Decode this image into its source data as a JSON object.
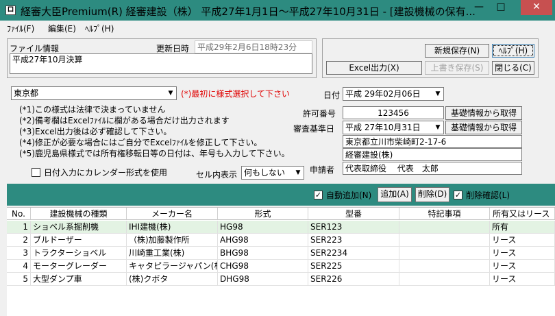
{
  "window": {
    "title": "経審大臣Premium(R)  経審建設（株）  平成27年1月1日～平成27年10月31日 - [建設機械の保有...",
    "app_icon": "ロ",
    "minimize": "—",
    "maximize": "□",
    "close": "✕"
  },
  "menu": [
    {
      "label": "ﾌｧｲﾙ(F)"
    },
    {
      "label": "編集(E)"
    },
    {
      "label": "ﾍﾙﾌﾟ(H)"
    }
  ],
  "file_info": {
    "label": "ファイル情報",
    "updated_label": "更新日時",
    "updated_value": "平成29年2月6日18時23分",
    "memo": "平成27年10月決算"
  },
  "buttons": {
    "new_save": "新規保存(N)",
    "help": "ﾍﾙﾌﾟ(H)",
    "excel": "Excel出力(X)",
    "overwrite": "上書き保存(S)",
    "close": "閉じる(C)"
  },
  "form": {
    "prefecture": "東京都",
    "prefecture_warning": "(*)最初に様式選択して下さい",
    "date_label": "日付",
    "date_value": "平成 29年02月06日",
    "notes": [
      "(*1)この様式は法律で決まっていません",
      "(*2)備考欄はExcelﾌｧｲﾙに欄がある場合だけ出力されます",
      "(*3)Excel出力後は必ず確認して下さい。",
      "(*4)修正が必要な場合にはご自分でExcelﾌｧｲﾙを修正して下さい。",
      "(*5)鹿児島県様式では所有権移転日等の日付は、年号も入力して下さい。"
    ],
    "permit_label": "許可番号",
    "permit_value": "123456",
    "basic_info_button": "基礎情報から取得",
    "review_date_label": "審査基準日",
    "review_date_value": "平成 27年10月31日",
    "address": "東京都立川市柴崎町2-17-6",
    "company": "経審建設(株)",
    "applicant_label": "申請者",
    "applicant": "代表取締役　 代表　太郎",
    "calendar_label": "日付入力にカレンダー形式を使用",
    "cell_display_label": "セル内表示",
    "cell_display_value": "何もしない"
  },
  "toolbar": {
    "auto_add": "自動追加(N)",
    "add": "追加(A)",
    "delete": "削除(D)",
    "delete_confirm": "削除確認(L)",
    "auto_add_checked": true,
    "delete_confirm_checked": true
  },
  "table": {
    "columns": [
      "No.",
      "建設機械の種類",
      "メーカー名",
      "形式",
      "型番",
      "特記事項",
      "所有又はリース"
    ],
    "rows": [
      {
        "no": "1",
        "type": "ショベル系掘削機",
        "maker": "IHI建機(株)",
        "model": "HG98",
        "serial": "SER123",
        "note": "",
        "own": "所有"
      },
      {
        "no": "2",
        "type": "ブルドーザー",
        "maker": "（株)加藤製作所",
        "model": "AHG98",
        "serial": "SER223",
        "note": "",
        "own": "リース"
      },
      {
        "no": "3",
        "type": "トラクターショベル",
        "maker": "川崎重工業(株)",
        "model": "BHG98",
        "serial": "SER2234",
        "note": "",
        "own": "リース"
      },
      {
        "no": "4",
        "type": "モーターグレーダー",
        "maker": "キャタピラージャパン(株",
        "model": "CHG98",
        "serial": "SER225",
        "note": "",
        "own": "リース"
      },
      {
        "no": "5",
        "type": "大型ダンプ車",
        "maker": "(株)クボタ",
        "model": "DHG98",
        "serial": "SER226",
        "note": "",
        "own": "リース"
      }
    ]
  },
  "colors": {
    "accent": "#2d8b80",
    "close": "#c75050",
    "warning": "#e00000"
  }
}
